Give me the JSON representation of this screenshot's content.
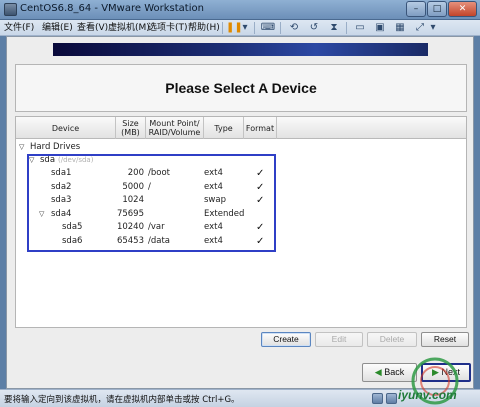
{
  "window": {
    "title": "CentOS6.8_64 - VMware Workstation",
    "minimize": "–",
    "maximize": "□",
    "close": "✕"
  },
  "menu": [
    "文件(F)",
    "编辑(E)",
    "查看(V)",
    "虚拟机(M)",
    "选项卡(T)",
    "帮助(H)"
  ],
  "toolbar": {
    "pause_icon": "pause-icon",
    "pause_glyph": "❚❚",
    "dropdown_glyph": "▾",
    "icons": [
      "send-keys-icon",
      "snapshot-icon",
      "revert-snapshot-icon",
      "snapshot-manager-icon",
      "fullscreen-icon",
      "unity-icon",
      "console-view-icon",
      "stretch-icon"
    ]
  },
  "installer": {
    "title": "Please Select A Device",
    "columns": [
      "Device",
      "Size (MB)",
      "Mount Point/ RAID/Volume",
      "Type",
      "Format"
    ],
    "group": "Hard Drives",
    "disk": {
      "name": "sda",
      "path": "(/dev/sda)"
    },
    "partitions": [
      {
        "device": "sda1",
        "size": "200",
        "mount": "/boot",
        "type": "ext4",
        "format": "✓",
        "level": 1
      },
      {
        "device": "sda2",
        "size": "5000",
        "mount": "/",
        "type": "ext4",
        "format": "✓",
        "level": 1
      },
      {
        "device": "sda3",
        "size": "1024",
        "mount": "",
        "type": "swap",
        "format": "✓",
        "level": 1
      },
      {
        "device": "sda4",
        "size": "75695",
        "mount": "",
        "type": "Extended",
        "format": "",
        "level": 1,
        "expandable": true
      },
      {
        "device": "sda5",
        "size": "10240",
        "mount": "/var",
        "type": "ext4",
        "format": "✓",
        "level": 2
      },
      {
        "device": "sda6",
        "size": "65453",
        "mount": "/data",
        "type": "ext4",
        "format": "✓",
        "level": 2
      }
    ],
    "buttons": {
      "create": "Create",
      "edit": "Edit",
      "delete": "Delete",
      "reset": "Reset"
    },
    "nav": {
      "back": "Back",
      "next": "Next"
    }
  },
  "statusbar": {
    "text": "要将输入定向到该虚拟机，请在虚拟机内部单击或按 Ctrl+G。"
  },
  "watermark": "iyunv.com"
}
